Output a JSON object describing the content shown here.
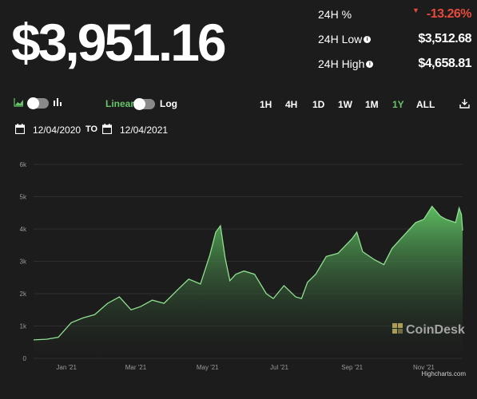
{
  "price": "$3,951.16",
  "stats": {
    "change_label": "24H %",
    "change_value": "-13.26%",
    "low_label": "24H Low",
    "low_value": "$3,512.68",
    "high_label": "24H High",
    "high_value": "$4,658.81"
  },
  "controls": {
    "scale_linear": "Linear",
    "scale_log": "Log",
    "ranges": [
      "1H",
      "4H",
      "1D",
      "1W",
      "1M",
      "1Y",
      "ALL"
    ],
    "active_range": "1Y",
    "start_date": "12/04/2020",
    "to_label": "TO",
    "end_date": "12/04/2021"
  },
  "colors": {
    "accent": "#67c66a",
    "negative": "#e54a3c",
    "background": "#1c1c1c"
  },
  "watermark": "CoinDesk",
  "credit": "Highcharts.com",
  "chart_data": {
    "type": "area",
    "x_tick_labels": [
      "Jan '21",
      "Mar '21",
      "May '21",
      "Jul '21",
      "Sep '21",
      "Nov '21"
    ],
    "y_tick_labels": [
      "0",
      "1k",
      "2k",
      "3k",
      "4k",
      "5k",
      "6k"
    ],
    "ylim": [
      0,
      6000
    ],
    "xlim": [
      "2020-12-04",
      "2021-12-04"
    ],
    "grid": true,
    "series": [
      {
        "x": [
          "2020-12-04",
          "2020-12-15",
          "2020-12-25",
          "2021-01-05",
          "2021-01-15",
          "2021-01-25",
          "2021-02-05",
          "2021-02-15",
          "2021-02-25",
          "2021-03-05",
          "2021-03-15",
          "2021-03-25",
          "2021-04-05",
          "2021-04-15",
          "2021-04-25",
          "2021-05-03",
          "2021-05-08",
          "2021-05-12",
          "2021-05-16",
          "2021-05-20",
          "2021-05-25",
          "2021-06-01",
          "2021-06-10",
          "2021-06-20",
          "2021-06-26",
          "2021-07-05",
          "2021-07-15",
          "2021-07-20",
          "2021-07-25",
          "2021-08-01",
          "2021-08-10",
          "2021-08-20",
          "2021-09-01",
          "2021-09-05",
          "2021-09-10",
          "2021-09-20",
          "2021-09-28",
          "2021-10-05",
          "2021-10-15",
          "2021-10-25",
          "2021-11-01",
          "2021-11-08",
          "2021-11-15",
          "2021-11-20",
          "2021-11-28",
          "2021-12-01",
          "2021-12-03",
          "2021-12-04"
        ],
        "y": [
          570,
          590,
          650,
          1100,
          1250,
          1350,
          1700,
          1900,
          1500,
          1600,
          1800,
          1700,
          2100,
          2450,
          2300,
          3200,
          3900,
          4100,
          3100,
          2400,
          2600,
          2700,
          2600,
          2000,
          1850,
          2250,
          1900,
          1850,
          2350,
          2600,
          3150,
          3250,
          3700,
          3900,
          3300,
          3050,
          2900,
          3400,
          3800,
          4200,
          4300,
          4700,
          4400,
          4300,
          4200,
          4650,
          4450,
          3950
        ]
      }
    ]
  }
}
